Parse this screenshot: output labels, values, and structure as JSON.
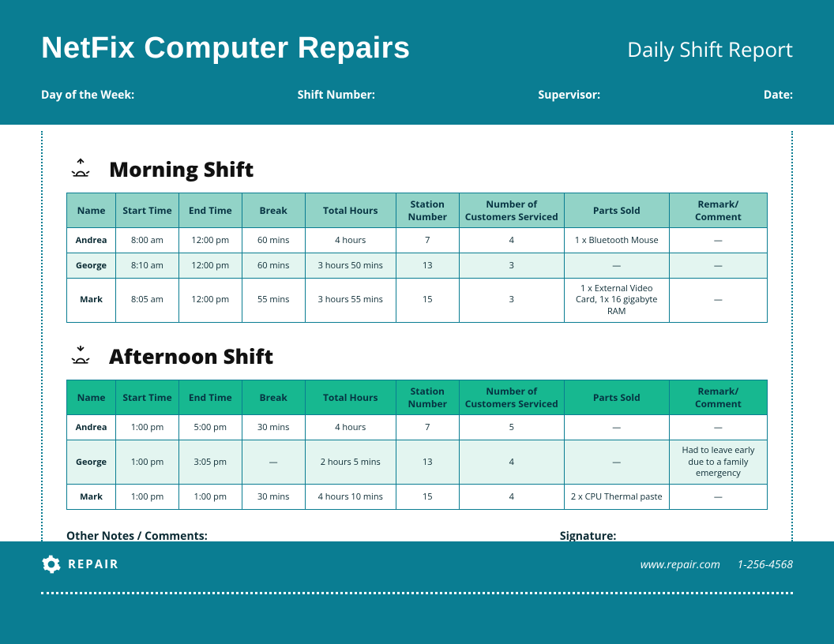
{
  "header": {
    "brand": "NetFix Computer Repairs",
    "report_title": "Daily Shift Report",
    "fields": {
      "day": "Day of the Week:",
      "shift": "Shift Number:",
      "supervisor": "Supervisor:",
      "date": "Date:"
    }
  },
  "columns": {
    "name": "Name",
    "start": "Start Time",
    "end": "End Time",
    "break": "Break",
    "total": "Total Hours",
    "station": "Station Number",
    "customers": "Number of Customers Serviced",
    "parts": "Parts Sold",
    "remark": "Remark/ Comment"
  },
  "morning": {
    "title": "Morning Shift",
    "rows": [
      {
        "name": "Andrea",
        "start": "8:00 am",
        "end": "12:00 pm",
        "break": "60 mins",
        "total": "4 hours",
        "station": "7",
        "cust": "4",
        "parts": "1 x Bluetooth Mouse",
        "remark": "—"
      },
      {
        "name": "George",
        "start": "8:10 am",
        "end": "12:00 pm",
        "break": "60 mins",
        "total": "3 hours 50 mins",
        "station": "13",
        "cust": "3",
        "parts": "—",
        "remark": "—"
      },
      {
        "name": "Mark",
        "start": "8:05 am",
        "end": "12:00 pm",
        "break": "55 mins",
        "total": "3 hours 55 mins",
        "station": "15",
        "cust": "3",
        "parts": "1 x External Video Card, 1x 16 gigabyte RAM",
        "remark": "—"
      }
    ]
  },
  "afternoon": {
    "title": "Afternoon Shift",
    "rows": [
      {
        "name": "Andrea",
        "start": "1:00 pm",
        "end": "5:00 pm",
        "break": "30 mins",
        "total": "4 hours",
        "station": "7",
        "cust": "5",
        "parts": "—",
        "remark": "—"
      },
      {
        "name": "George",
        "start": "1:00 pm",
        "end": "3:05 pm",
        "break": "—",
        "total": "2 hours 5 mins",
        "station": "13",
        "cust": "4",
        "parts": "—",
        "remark": "Had to leave early due to a family emergency"
      },
      {
        "name": "Mark",
        "start": "1:00 pm",
        "end": "1:00 pm",
        "break": "30 mins",
        "total": "4 hours 10 mins",
        "station": "15",
        "cust": "4",
        "parts": "2 x CPU Thermal paste",
        "remark": "—"
      }
    ]
  },
  "notes": {
    "label": "Other Notes / Comments:",
    "signature": "Signature:"
  },
  "footer": {
    "brand": "REPAIR",
    "site": "www.repair.com",
    "phone": "1-256-4568"
  }
}
